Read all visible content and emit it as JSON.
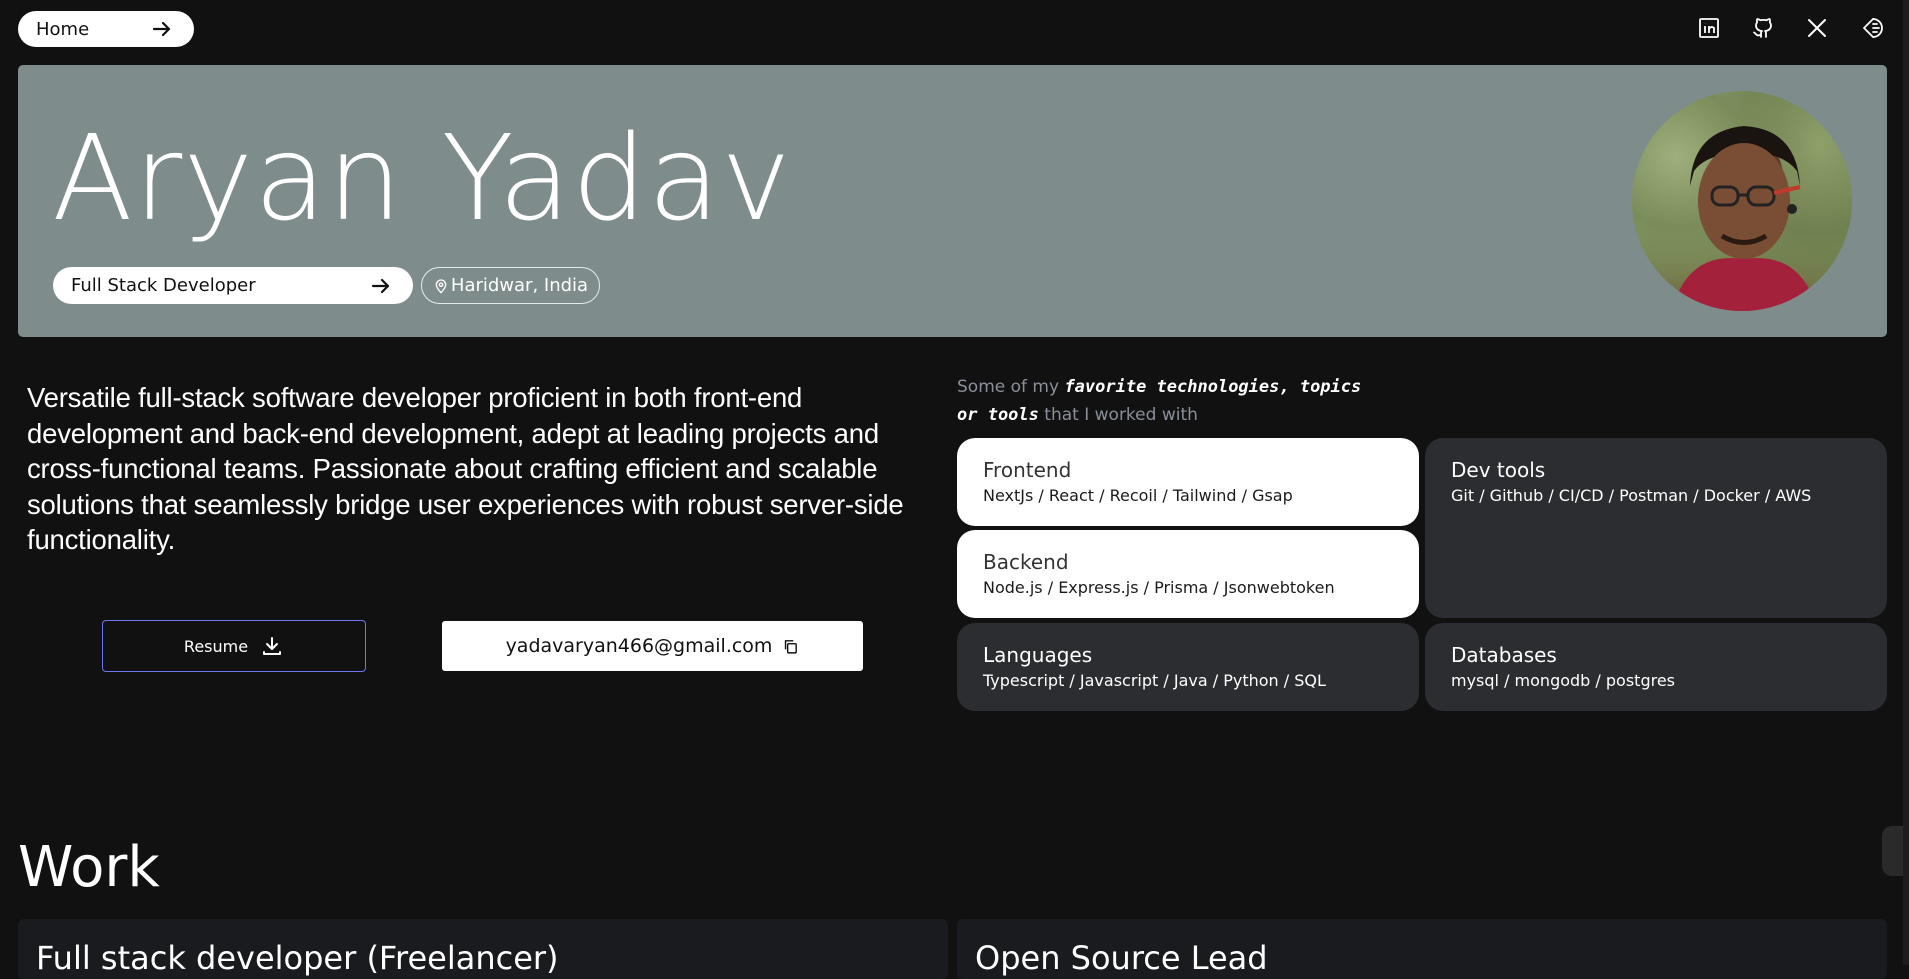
{
  "nav": {
    "home_label": "Home",
    "icons": [
      "linkedin-icon",
      "github-icon",
      "x-icon",
      "theme-toggle-icon"
    ]
  },
  "hero": {
    "name": "Aryan Yadav",
    "role": "Full Stack Developer",
    "location": "Haridwar, India",
    "background": "#7e8c8b"
  },
  "about": {
    "bio": "Versatile full-stack software developer proficient in both front-end development and back-end development, adept at leading projects and cross-functional teams. Passionate about crafting efficient and scalable solutions that seamlessly bridge user experiences with robust server-side functionality.",
    "resume_label": "Resume",
    "email": "yadavaryan466@gmail.com"
  },
  "tech": {
    "intro_pre": "Some of my",
    "intro_em": "favorite technologies, topics or tools",
    "intro_post": "that I worked with",
    "cards": [
      {
        "title": "Frontend",
        "items": "NextJs / React / Recoil / Tailwind / Gsap"
      },
      {
        "title": "Dev tools",
        "items": "Git / Github / CI/CD / Postman / Docker / AWS"
      },
      {
        "title": "Backend",
        "items": "Node.js / Express.js / Prisma / Jsonwebtoken"
      },
      {
        "title": "Languages",
        "items": "Typescript / Javascript / Java / Python / SQL"
      },
      {
        "title": "Databases",
        "items": "mysql / mongodb / postgres"
      }
    ]
  },
  "work": {
    "heading": "Work",
    "items": [
      {
        "title": "Full stack developer (Freelancer)"
      },
      {
        "title": "Open Source Lead"
      }
    ]
  }
}
